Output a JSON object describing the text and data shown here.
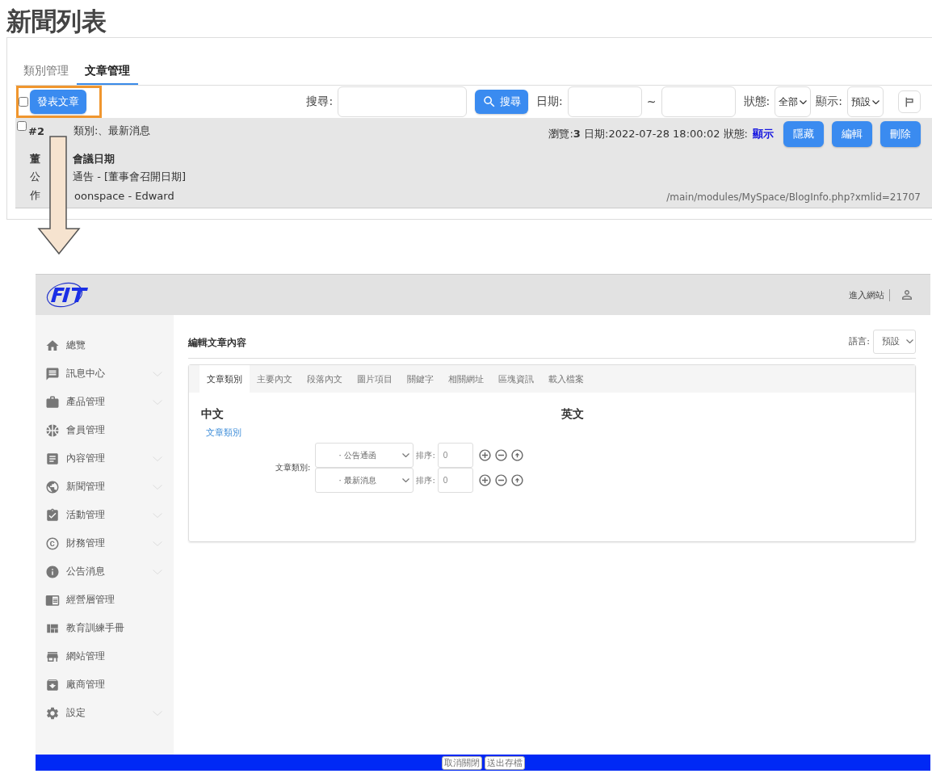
{
  "page_title": "新聞列表",
  "list_panel": {
    "tabs": [
      {
        "label": "類別管理",
        "selected": false
      },
      {
        "label": "文章管理",
        "selected": true
      }
    ],
    "toolbar": {
      "select_all_checked": false,
      "post_button": "發表文章",
      "highlighted": true,
      "search_label": "搜尋:",
      "search_button": "搜尋",
      "date_label": "日期:",
      "date_separator": "~",
      "status_label": "狀態:",
      "status_value": "全部",
      "display_label": "顯示:",
      "display_value": "預設"
    },
    "rows": [
      {
        "checked": false,
        "id_visible": "#2",
        "category_visible": "類別:、最新消息",
        "title_visible_left": "董",
        "title_visible_right": "會議日期",
        "summary_visible_left": "公",
        "summary_visible_right": "通告 - [董事會召開日期]",
        "author_visible_left": "作",
        "author_visible_right": "oonspace - Edward",
        "meta": "瀏覽:**3** 日期:2022-07-28 18:00:02 狀態:",
        "status": "顯示",
        "buttons": [
          "隱藏",
          "編輯",
          "刪除"
        ],
        "url": "/main/modules/MySpace/BlogInfo.php?xmlid=21707"
      }
    ]
  },
  "editor": {
    "header": {
      "enter_site": "進入網站"
    },
    "sidebar": {
      "items": [
        {
          "label": "總覽",
          "has_submenu": false
        },
        {
          "label": "訊息中心",
          "has_submenu": true
        },
        {
          "label": "產品管理",
          "has_submenu": true
        },
        {
          "label": "會員管理",
          "has_submenu": false
        },
        {
          "label": "內容管理",
          "has_submenu": true
        },
        {
          "label": "新聞管理",
          "has_submenu": true
        },
        {
          "label": "活動管理",
          "has_submenu": true
        },
        {
          "label": "財務管理",
          "has_submenu": true
        },
        {
          "label": "公告消息",
          "has_submenu": true
        },
        {
          "label": "經營層管理",
          "has_submenu": false
        },
        {
          "label": "教育訓練手冊",
          "has_submenu": false
        },
        {
          "label": "網站管理",
          "has_submenu": false
        },
        {
          "label": "廠商管理",
          "has_submenu": false
        },
        {
          "label": "設定",
          "has_submenu": true
        }
      ]
    },
    "title": "編輯文章內容",
    "language_label": "語言:",
    "language_value": "預設",
    "tabs": [
      {
        "label": "文章類別",
        "selected": true
      },
      {
        "label": "主要內文",
        "selected": false
      },
      {
        "label": "段落內文",
        "selected": false
      },
      {
        "label": "圖片項目",
        "selected": false
      },
      {
        "label": "關鍵字",
        "selected": false
      },
      {
        "label": "相關網址",
        "selected": false
      },
      {
        "label": "區塊資訊",
        "selected": false
      },
      {
        "label": "載入檔案",
        "selected": false
      }
    ],
    "chinese_heading": "中文",
    "english_heading": "英文",
    "section_link": "文章類別",
    "category_label": "文章類別:",
    "categories": [
      {
        "value": "· 公告通函",
        "order_label": "排序:",
        "order": "0"
      },
      {
        "value": "· 最新消息",
        "order_label": "排序:",
        "order": "0"
      }
    ],
    "footer_buttons": [
      "取消關閉",
      "送出存檔"
    ]
  }
}
